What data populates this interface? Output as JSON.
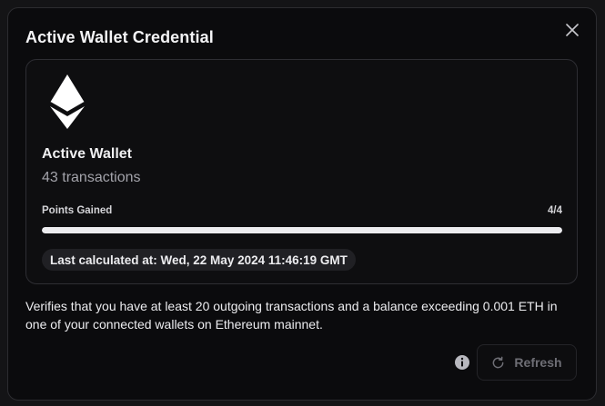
{
  "dialog": {
    "title": "Active Wallet Credential",
    "close_icon": "close-icon"
  },
  "card": {
    "logo_icon": "ethereum-icon",
    "name": "Active Wallet",
    "subtitle": "43 transactions",
    "points_label": "Points Gained",
    "points_value": "4/4",
    "progress_fraction": 1.0,
    "last_calculated": "Last calculated at: Wed, 22 May 2024 11:46:19 GMT"
  },
  "description": "Verifies that you have at least 20 outgoing transactions and a balance exceeding 0.001 ETH in one of your connected wallets on Ethereum mainnet.",
  "footer": {
    "info_icon": "info-icon",
    "refresh_icon": "refresh-icon",
    "refresh_label": "Refresh"
  },
  "colors": {
    "background": "#0b0b0d",
    "text": "#ececef",
    "muted": "#a3a3aa",
    "progress_fill": "#ececef",
    "disabled": "#6e6e75"
  }
}
